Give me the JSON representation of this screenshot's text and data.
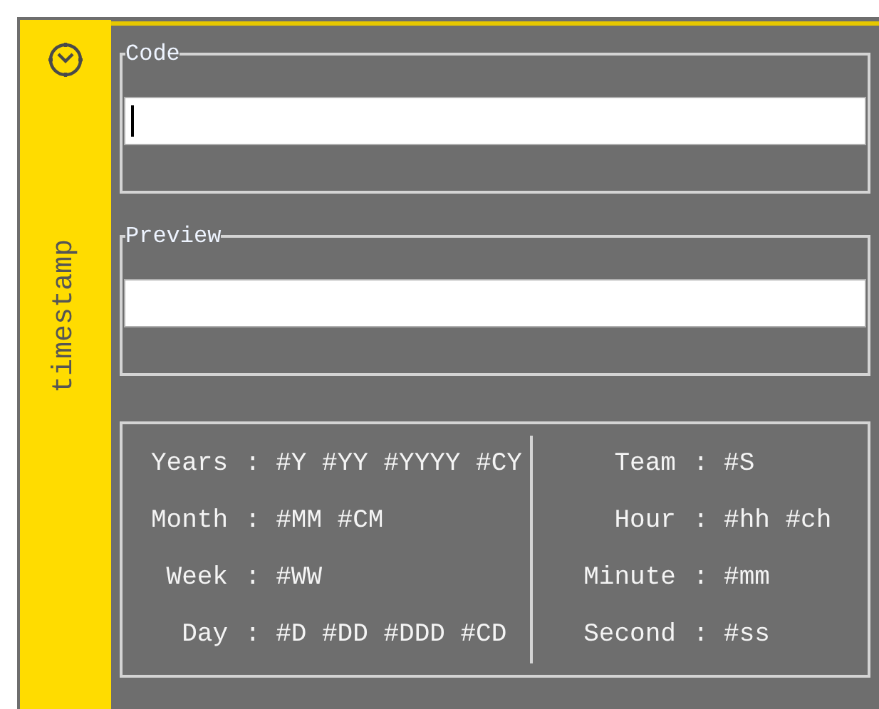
{
  "sidebar": {
    "title": "timestamp"
  },
  "code": {
    "legend": "Code",
    "focused": true
  },
  "preview": {
    "legend": "Preview"
  },
  "legend_table": {
    "columns": [
      {
        "rows": [
          {
            "label": "Years",
            "value": ": #Y #YY #YYYY #CY"
          },
          {
            "label": "Month",
            "value": ": #MM #CM"
          },
          {
            "label": "Week",
            "value": ": #WW"
          },
          {
            "label": "Day",
            "value": ": #D #DD #DDD #CD"
          }
        ]
      },
      {
        "rows": [
          {
            "label": "Team",
            "value": ": #S"
          },
          {
            "label": "Hour",
            "value": ": #hh #ch"
          },
          {
            "label": "Minute",
            "value": ": #mm"
          },
          {
            "label": "Second",
            "value": ": #ss"
          }
        ]
      }
    ]
  }
}
